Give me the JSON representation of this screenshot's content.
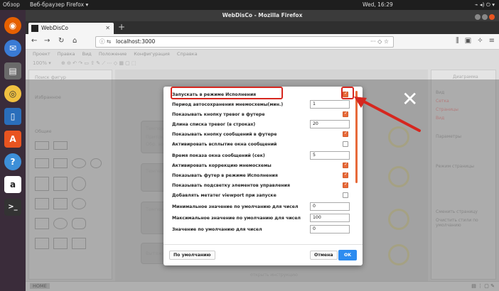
{
  "system": {
    "activities": "Обзор",
    "app_menu": "Веб-браузер Firefox ▾",
    "clock": "Wed, 16:29"
  },
  "launcher": {
    "items": [
      "firefox-icon",
      "thunderbird-icon",
      "files-icon",
      "rhythmbox-icon",
      "writer-icon",
      "software-icon",
      "help-icon",
      "amazon-icon",
      "terminal-icon"
    ]
  },
  "window": {
    "title": "WebDisCo - Mozilla Firefox",
    "tab_title": "WebDisCo",
    "url": "localhost:3000"
  },
  "app": {
    "menu": [
      "Проект",
      "Правка",
      "Вид",
      "Положение",
      "Конфигурация",
      "Справка"
    ],
    "zoom": "100% ▾",
    "left_search": "Поиск фигур",
    "left_sections": [
      "Избранное",
      "Общие"
    ],
    "cards": [
      "Температура",
      "Температура",
      "Температура",
      "Вытяжка вкл"
    ],
    "card_sub": [
      "Притоки",
      "Обр. вода",
      "Влажность"
    ],
    "right_title": "Диаграмма",
    "right_labels": [
      "Вид",
      "Сетка",
      "Страницы",
      "Вид",
      "Параметры",
      "Режим страницы",
      "Сменить страницу",
      "Очистить стили по умолчанию"
    ],
    "status_home": "HOME",
    "canvas_footer": "открыть инструкцию"
  },
  "dialog": {
    "settings": [
      {
        "label": "Запускать в режиме Исполнения",
        "type": "checkbox",
        "checked": true
      },
      {
        "label": "Период автосохранения мнемосхемы(мин.)",
        "type": "input",
        "value": "1"
      },
      {
        "label": "Показывать кнопку тревог в футере",
        "type": "checkbox",
        "checked": true
      },
      {
        "label": "Длина списка тревог (в строках)",
        "type": "input",
        "value": "20"
      },
      {
        "label": "Показывать кнопку сообщений в футере",
        "type": "checkbox",
        "checked": true
      },
      {
        "label": "Активировать всплытие окна сообщений",
        "type": "checkbox",
        "checked": false
      },
      {
        "label": "Время показа окна сообщений (сек)",
        "type": "input",
        "value": "5"
      },
      {
        "label": "Активировать коррекцию мнемосхемы",
        "type": "checkbox",
        "checked": true
      },
      {
        "label": "Показывать футер в режиме Исполнения",
        "type": "checkbox",
        "checked": true
      },
      {
        "label": "Показывать подсветку элементов управления",
        "type": "checkbox",
        "checked": true
      },
      {
        "label": "Добавлять метатег viewport при запуске",
        "type": "checkbox",
        "checked": false
      },
      {
        "label": "Минимальное значение по умолчанию для чисел",
        "type": "input",
        "value": "0"
      },
      {
        "label": "Максимальное значение по умолчанию для чисел",
        "type": "input",
        "value": "100"
      },
      {
        "label": "Значение по умолчанию для чисел",
        "type": "input",
        "value": "0"
      }
    ],
    "default_button": "По умолчанию",
    "cancel_button": "Отмена",
    "ok_button": "OK"
  },
  "colors": {
    "accent": "#e76a3a",
    "highlight": "#d6271f",
    "ok": "#2d8cf0"
  }
}
